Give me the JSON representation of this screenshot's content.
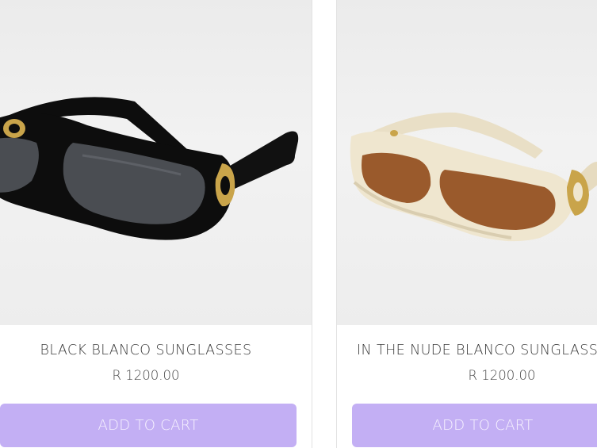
{
  "products": [
    {
      "name": "BLACK BLANCO SUNGLASSES",
      "price": "R 1200.00",
      "button_label": "ADD TO CART",
      "frame_color": "#0d0d0d",
      "lens_color": "#4a4d52"
    },
    {
      "name": "IN THE NUDE BLANCO SUNGLASSES",
      "price": "R 1200.00",
      "button_label": "ADD TO CART",
      "frame_color": "#efe6cf",
      "lens_color": "#9a5a2c"
    }
  ],
  "colors": {
    "button_bg": "#c3aff4",
    "button_text": "#f8f4ff",
    "accent_gold": "#c9a44a"
  }
}
